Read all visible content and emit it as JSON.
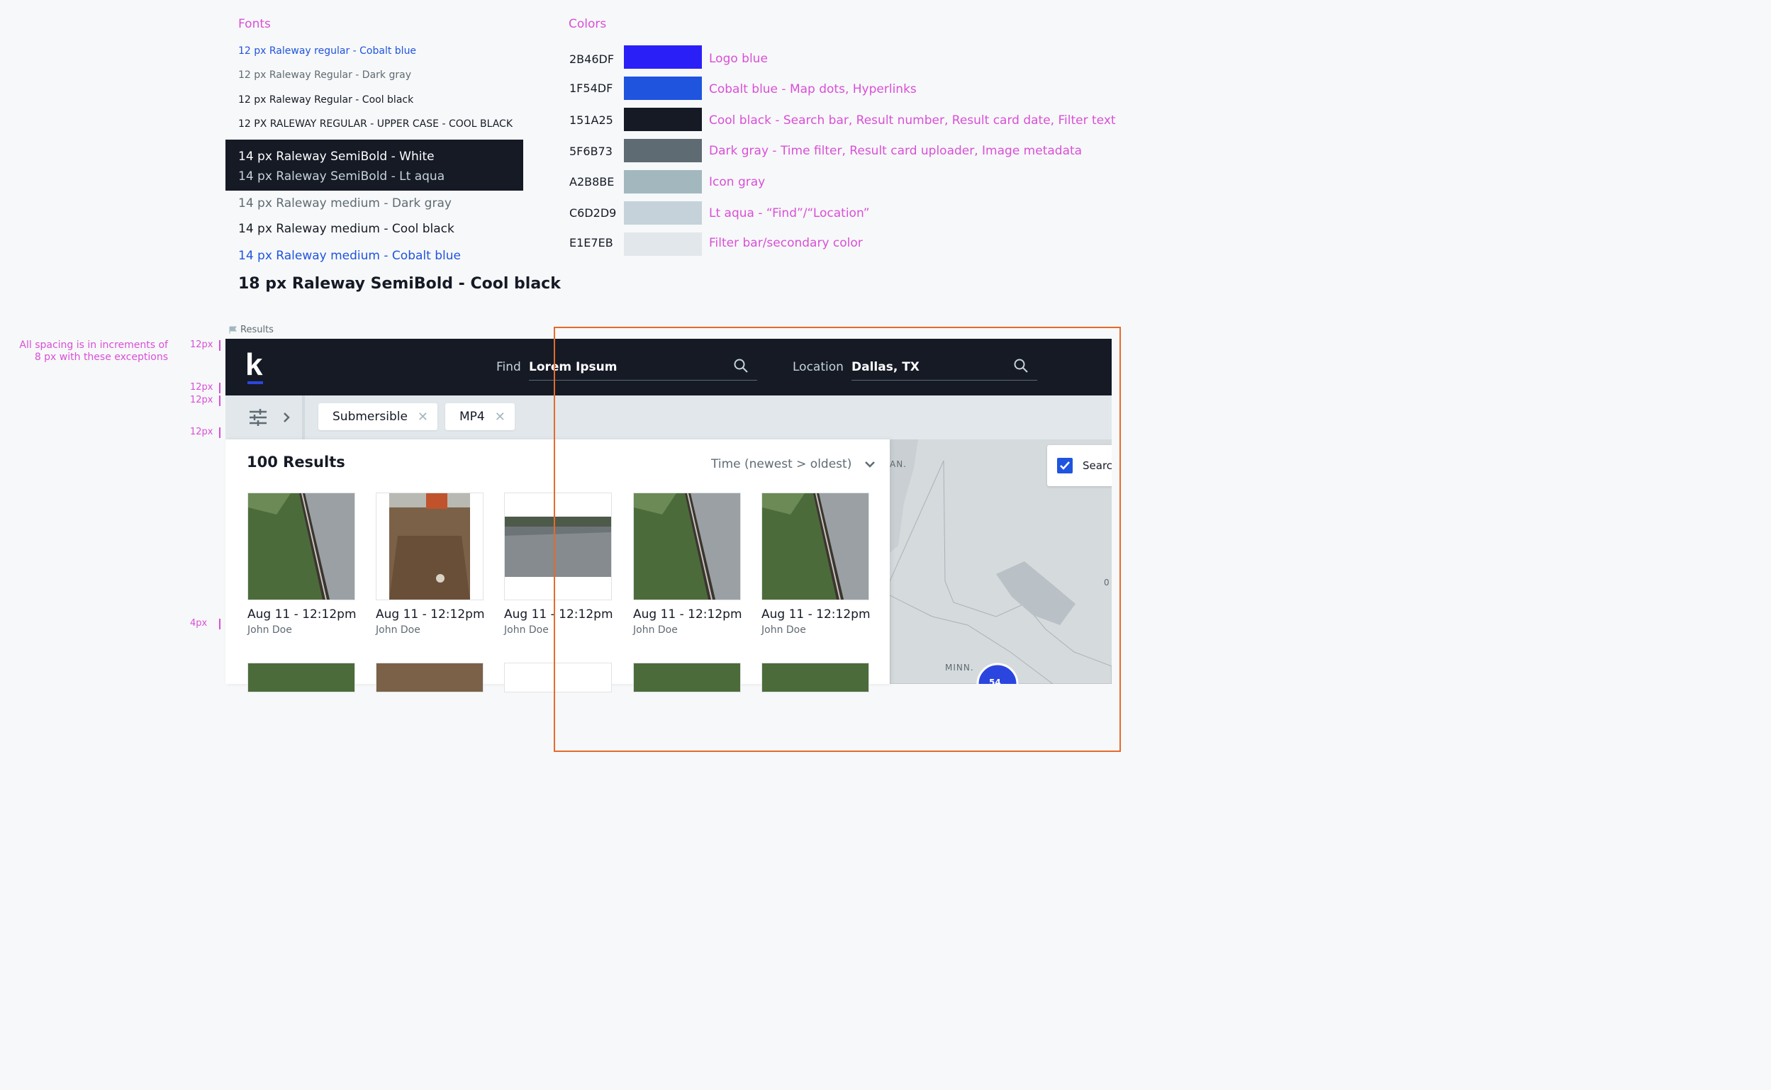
{
  "fonts": {
    "heading": "Fonts",
    "samples": [
      {
        "text": "12 px Raleway regular - Cobalt blue"
      },
      {
        "text": "12 px Raleway Regular - Dark gray"
      },
      {
        "text": "12 px Raleway Regular - Cool black"
      },
      {
        "text": "12 PX RALEWAY REGULAR - UPPER CASE - COOL BLACK"
      },
      {
        "text": "14 px Raleway SemiBold - White"
      },
      {
        "text": "14 px Raleway SemiBold - Lt aqua"
      },
      {
        "text": "14 px Raleway medium - Dark gray"
      },
      {
        "text": "14 px Raleway medium - Cool black"
      },
      {
        "text": "14 px Raleway medium - Cobalt blue"
      },
      {
        "text": "18 px Raleway SemiBold - Cool black"
      }
    ]
  },
  "colors": {
    "heading": "Colors",
    "swatches": [
      {
        "hex": "2B46DF",
        "color": "#2b1ff7",
        "desc": "Logo blue"
      },
      {
        "hex": "1F54DF",
        "color": "#1f54df",
        "desc": "Cobalt blue - Map dots, Hyperlinks"
      },
      {
        "hex": "151A25",
        "color": "#151a25",
        "desc": "Cool black - Search bar, Result number,  Result card date, Filter text"
      },
      {
        "hex": "5F6B73",
        "color": "#5f6b73",
        "desc": "Dark gray - Time filter, Result card uploader, Image metadata"
      },
      {
        "hex": "A2B8BE",
        "color": "#a2b8be",
        "desc": "Icon gray"
      },
      {
        "hex": "C6D2D9",
        "color": "#c6d2d9",
        "desc": "Lt aqua - “Find”/“Location”"
      },
      {
        "hex": "E1E7EB",
        "color": "#e1e7eb",
        "desc": "Filter bar/secondary color"
      }
    ]
  },
  "spacing": {
    "note_line1": "All spacing is in increments of",
    "note_line2": "8 px with these exceptions",
    "labels": [
      "12px",
      "12px",
      "12px",
      "12px",
      "4px"
    ]
  },
  "frame_label": "Results",
  "app": {
    "logo": "k",
    "find_label": "Find",
    "find_value": "Lorem Ipsum",
    "location_label": "Location",
    "location_value": "Dallas, TX",
    "chips": [
      "Submersible",
      "MP4"
    ],
    "results_count": "100 Results",
    "sort_label": "Time (newest > oldest)",
    "map_checkbox_label": "Searc",
    "map_labels": {
      "state": "MINN.",
      "edge": "AN.",
      "zero": "0",
      "cluster": "54"
    },
    "cards": [
      {
        "date": "Aug 11 - 12:12pm",
        "user": "John Doe"
      },
      {
        "date": "Aug 11 - 12:12pm",
        "user": "John Doe"
      },
      {
        "date": "Aug 11 - 12:12pm",
        "user": "John Doe"
      },
      {
        "date": "Aug 11 - 12:12pm",
        "user": "John Doe"
      },
      {
        "date": "Aug 11 - 12:12pm",
        "user": "John Doe"
      }
    ]
  }
}
